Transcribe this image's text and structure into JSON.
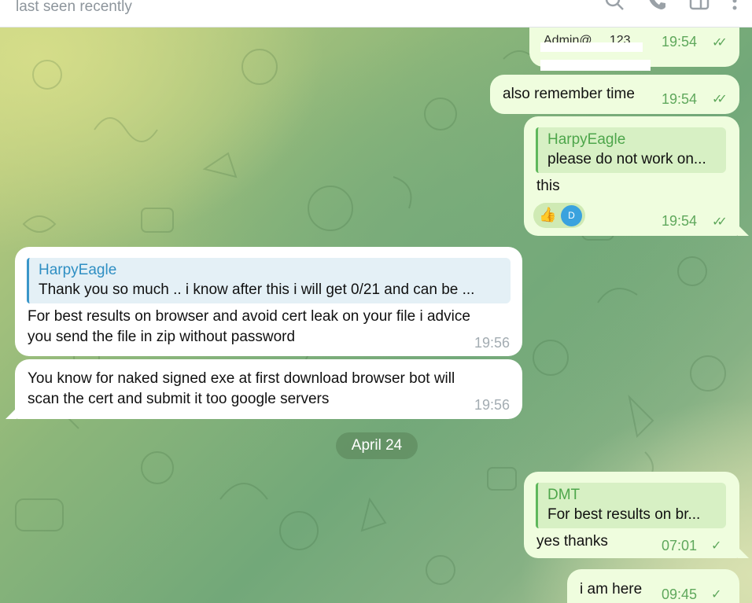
{
  "header": {
    "status": "last seen recently"
  },
  "messages": [
    {
      "text": "Admin@ ... 123",
      "time": "19:54"
    },
    {
      "text": "also remember time",
      "time": "19:54"
    },
    {
      "reply_name": "HarpyEagle",
      "reply_snippet": "please do not work on...",
      "text": "this",
      "time": "19:54",
      "reaction_emoji": "👍",
      "reaction_avatar": "D"
    },
    {
      "reply_name": "HarpyEagle",
      "reply_snippet": "Thank you so much .. i know after this i will get 0/21 and can be ...",
      "text_line1": "For best results on browser and avoid cert leak on your file i advice",
      "text_line2": "you send the file in zip without password",
      "time": "19:56"
    },
    {
      "text_line1": "You know for naked signed exe at first download browser bot will",
      "text_line2": "scan the cert and submit it too google servers",
      "time": "19:56"
    },
    {
      "reply_name": "DMT",
      "reply_snippet": "For best results on br...",
      "text": "yes thanks",
      "time": "07:01"
    },
    {
      "text": "i am here",
      "time": "09:45"
    }
  ],
  "date_separator": "April 24",
  "icons": [
    "search-icon",
    "phone-icon",
    "sidebar-icon",
    "more-icon",
    "double-check-icon",
    "single-check-icon",
    "thumbs-up-icon"
  ],
  "colors": {
    "outgoing": "#effdde",
    "incoming": "#ffffff",
    "accent_green": "#5fa85c",
    "accent_blue": "#2f8fc3"
  }
}
